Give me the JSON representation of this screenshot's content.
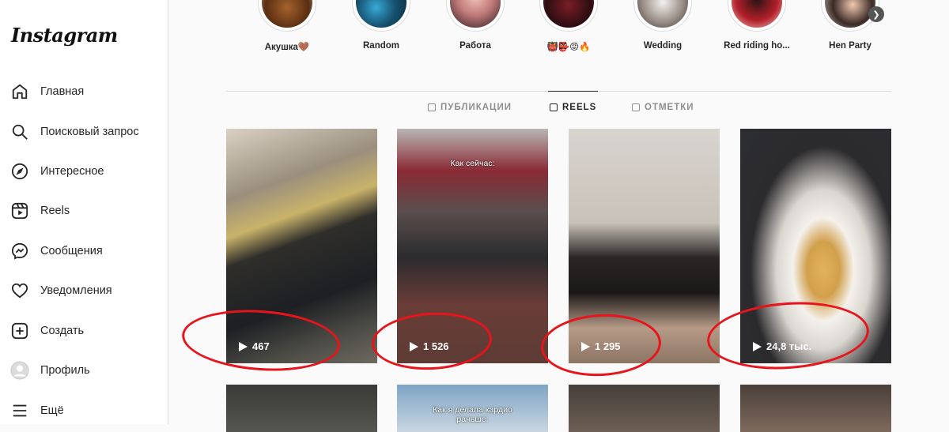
{
  "brand": {
    "logo": "Instagram"
  },
  "nav": [
    {
      "label": "Главная",
      "icon": "home-icon"
    },
    {
      "label": "Поисковый запрос",
      "icon": "search-icon"
    },
    {
      "label": "Интересное",
      "icon": "compass-icon"
    },
    {
      "label": "Reels",
      "icon": "reels-icon"
    },
    {
      "label": "Сообщения",
      "icon": "messenger-icon"
    },
    {
      "label": "Уведомления",
      "icon": "heart-icon"
    },
    {
      "label": "Создать",
      "icon": "create-icon"
    },
    {
      "label": "Профиль",
      "icon": "avatar-icon"
    },
    {
      "label": "Ещё",
      "icon": "menu-icon"
    }
  ],
  "highlights": [
    {
      "label": "Акушка🤎"
    },
    {
      "label": "Random"
    },
    {
      "label": "Работа"
    },
    {
      "label": "👹👺😡🔥"
    },
    {
      "label": "Wedding"
    },
    {
      "label": "Red riding ho..."
    },
    {
      "label": "Hen Party"
    }
  ],
  "tabs": [
    {
      "label": "ПУБЛИКАЦИИ",
      "active": false
    },
    {
      "label": "REELS",
      "active": true
    },
    {
      "label": "ОТМЕТКИ",
      "active": false
    }
  ],
  "reels": [
    {
      "views": "467",
      "caption": ""
    },
    {
      "views": "1 526",
      "caption": "Как сейчас:"
    },
    {
      "views": "1 295",
      "caption": ""
    },
    {
      "views": "24,8 тыс.",
      "caption": ""
    }
  ],
  "reels_row2": [
    {
      "caption": ""
    },
    {
      "caption": "Как я делала кардио раньше:"
    },
    {
      "caption": ""
    },
    {
      "caption": ""
    }
  ],
  "colors": {
    "annotation": "#e8141b",
    "border": "#dbdbdb",
    "text": "#262626",
    "muted": "#8e8e8e"
  }
}
